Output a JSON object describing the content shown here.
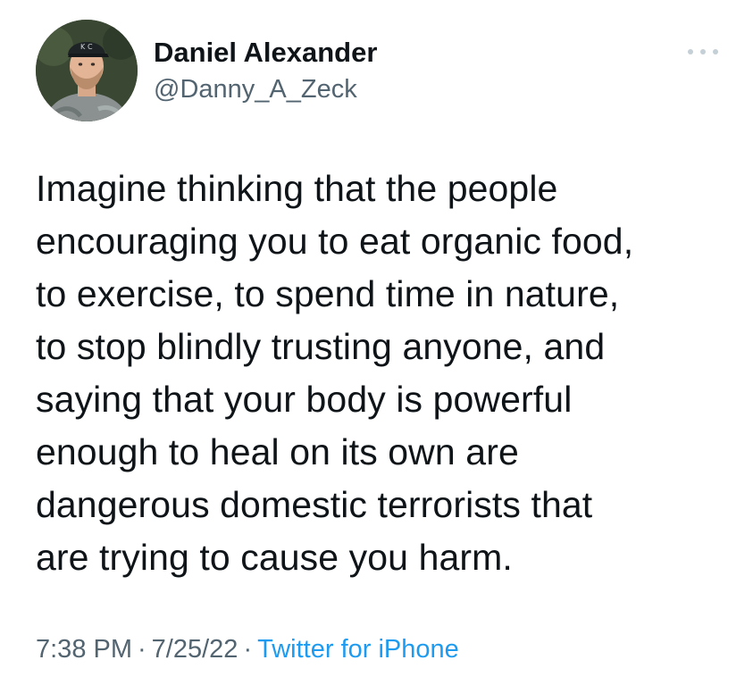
{
  "author": {
    "display_name": "Daniel Alexander",
    "handle": "@Danny_A_Zeck"
  },
  "tweet": {
    "lines": [
      "Imagine thinking that the people",
      "encouraging you to eat organic food,",
      "to exercise, to spend time in nature,",
      "to stop blindly trusting anyone, and",
      "saying that your body is powerful",
      "enough to heal on its own are",
      "dangerous domestic terrorists that",
      "are trying to cause you harm."
    ]
  },
  "meta": {
    "time": "7:38 PM",
    "date": "7/25/22",
    "separator": "·",
    "source": "Twitter for iPhone"
  },
  "icons": {
    "more": "more-options-icon"
  },
  "colors": {
    "text_primary": "#0f1419",
    "text_secondary": "#536471",
    "link": "#1d9bf0"
  }
}
